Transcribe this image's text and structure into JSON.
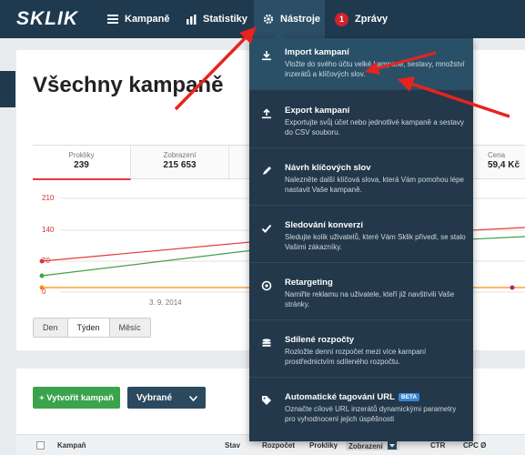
{
  "logo": "SKLIK",
  "nav": {
    "campaigns": "Kampaně",
    "statistics": "Statistiky",
    "tools": "Nástroje",
    "messages": "Zprávy",
    "messages_count": "1"
  },
  "page_title": "Všechny kampaně",
  "stats": [
    {
      "label": "Prokliky",
      "value": "239"
    },
    {
      "label": "Zobrazení",
      "value": "215 653"
    },
    {
      "label": "Cena",
      "value": "59,4 Kč"
    }
  ],
  "chart_data": {
    "type": "line",
    "y_ticks": [
      "210",
      "140",
      "70",
      "0"
    ],
    "x_ticks": [
      "3. 9. 2014"
    ],
    "series": [
      {
        "color": "#e53935"
      },
      {
        "color": "#43a047"
      },
      {
        "color": "#ff8f00"
      }
    ]
  },
  "period": {
    "options": [
      "Den",
      "Týden",
      "Měsíc"
    ],
    "selected": "Týden"
  },
  "buttons": {
    "create": "+ Vytvořit kampaň",
    "selected": "Vybrané"
  },
  "table": {
    "headers": [
      "Kampaň",
      "Stav",
      "Rozpočet",
      "Prokliky",
      "Zobrazení",
      "CTR",
      "CPC Ø"
    ]
  },
  "tools_menu": [
    {
      "title": "Import kampaní",
      "desc": "Vložte do svého účtu velké kampaně, sestavy, množství inzerátů a klíčových slov.",
      "icon": "download-icon"
    },
    {
      "title": "Export kampaní",
      "desc": "Exportujte svůj účet nebo jednotlivé kampaně a sestavy do CSV souboru.",
      "icon": "upload-icon"
    },
    {
      "title": "Návrh klíčových slov",
      "desc": "Nalezněte další klíčová slova, která Vám pomohou lépe nastavit Vaše kampaně.",
      "icon": "pencil-icon"
    },
    {
      "title": "Sledování konverzí",
      "desc": "Sledujte kolik uživatelů, které Vám Sklik přivedl, se stalo Vašimi zákazníky.",
      "icon": "checkmark-icon"
    },
    {
      "title": "Retargeting",
      "desc": "Namiřte reklamu na uživatele, kteří již navštívili Vaše stránky.",
      "icon": "target-icon"
    },
    {
      "title": "Sdílené rozpočty",
      "desc": "Rozložte denní rozpočet mezi více kampaní prostřednictvím sdíleného rozpočtu.",
      "icon": "coins-icon"
    },
    {
      "title": "Automatické tagování URL",
      "desc": "Označte cílové URL inzerátů dynamickými parametry pro vyhodnocení jejich úspěšnosti",
      "icon": "tag-icon",
      "badge": "BETA"
    }
  ]
}
